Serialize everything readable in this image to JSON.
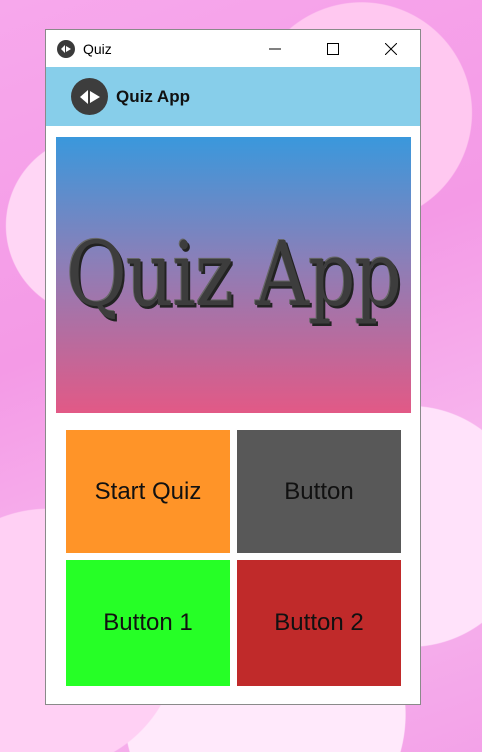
{
  "window": {
    "title": "Quiz",
    "controls": [
      "minimize",
      "maximize",
      "close"
    ]
  },
  "appbar": {
    "title": "Quiz App",
    "logo_icon": "kivy-logo-icon"
  },
  "banner": {
    "text": "Quiz App"
  },
  "buttons": {
    "start_quiz": "Start Quiz",
    "button": "Button",
    "button_1": "Button 1",
    "button_2": "Button 2"
  },
  "colors": {
    "appbar": "#87ceea",
    "start_quiz": "#ff9428",
    "button": "#585858",
    "button_1": "#26ff26",
    "button_2": "#c02a2a"
  }
}
